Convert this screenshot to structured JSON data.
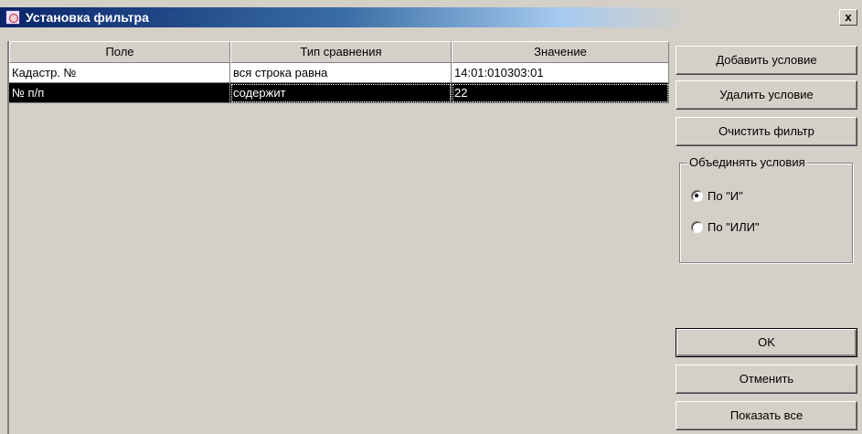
{
  "window": {
    "title": "Установка фильтра",
    "close_label": "x"
  },
  "grid": {
    "columns": [
      "Поле",
      "Тип сравнения",
      "Значение"
    ],
    "rows": [
      {
        "field": "Кадастр. №",
        "comparison": "вся строка равна",
        "value": "14:01:010303:01",
        "selected": false
      },
      {
        "field": "№ п/п",
        "comparison": "содержит",
        "value": "22",
        "selected": true
      }
    ]
  },
  "buttons": {
    "add_condition": "Добавить условие",
    "remove_condition": "Удалить условие",
    "clear_filter": "Очистить фильтр",
    "ok": "OK",
    "cancel": "Отменить",
    "show_all": "Показать все"
  },
  "combine": {
    "label": "Объединять условия",
    "options": [
      {
        "label": "По \"И\"",
        "checked": true
      },
      {
        "label": "По \"ИЛИ\"",
        "checked": false
      }
    ]
  },
  "colors": {
    "title_gradient_start": "#0a246a",
    "face": "#d4d0c8",
    "selection": "#000000"
  }
}
